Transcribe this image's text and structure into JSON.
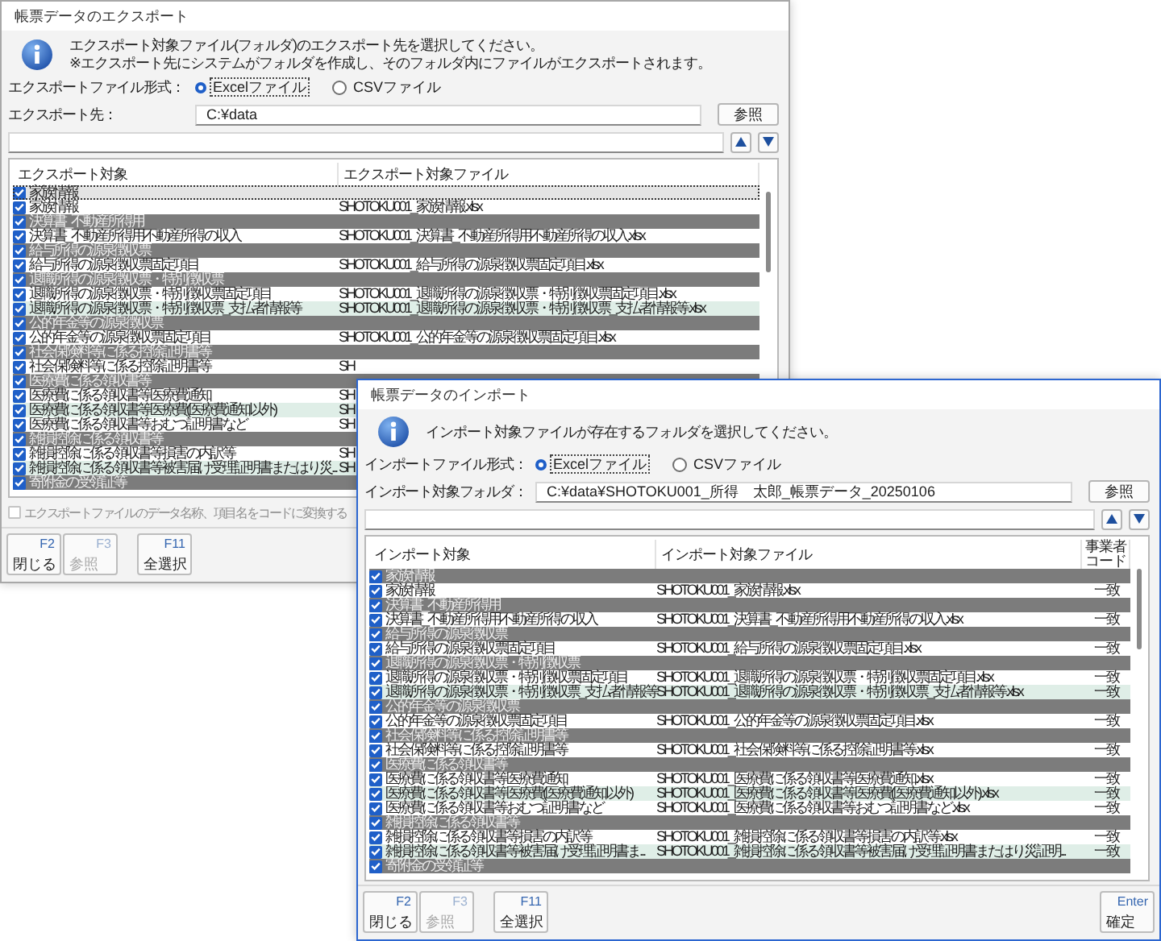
{
  "export_window": {
    "title": "帳票データのエクスポート",
    "active": false,
    "message": [
      "エクスポート対象ファイル(フォルダ)のエクスポート先を選択してください。",
      "※エクスポート先にシステムがフォルダを作成し、そのフォルダ内にファイルがエクスポートされます。"
    ],
    "format": {
      "label": "エクスポートファイル形式：",
      "options": [
        {
          "label": "Excelファイル",
          "selected": true
        },
        {
          "label": "CSVファイル",
          "selected": false
        }
      ]
    },
    "path": {
      "label": "エクスポート先：",
      "value": "C:¥data",
      "button": "参照"
    },
    "table": {
      "columns": [
        "エクスポート対象",
        "エクスポート対象ファイル"
      ],
      "rows": [
        {
          "kind": "group",
          "checked": true,
          "selected": true,
          "cells": [
            "家族情報"
          ]
        },
        {
          "kind": "item",
          "checked": true,
          "selected": false,
          "tinted": false,
          "cells": [
            "家族情報",
            "SHOTOKU001_家族情報.xlsx"
          ]
        },
        {
          "kind": "group",
          "checked": true,
          "selected": false,
          "cells": [
            "決算書_不動産所得用"
          ]
        },
        {
          "kind": "item",
          "checked": true,
          "selected": false,
          "tinted": false,
          "cells": [
            "決算書_不動産所得用不動産所得の収入",
            "SHOTOKU001_決算書_不動産所得用不動産所得の収入.xlsx"
          ]
        },
        {
          "kind": "group",
          "checked": true,
          "selected": false,
          "cells": [
            "給与所得の源泉徴収票"
          ]
        },
        {
          "kind": "item",
          "checked": true,
          "selected": false,
          "tinted": false,
          "cells": [
            "給与所得の源泉徴収票固定項目",
            "SHOTOKU001_給与所得の源泉徴収票固定項目.xlsx"
          ]
        },
        {
          "kind": "group",
          "checked": true,
          "selected": false,
          "cells": [
            "退職所得の源泉徴収票・特別徴収票"
          ]
        },
        {
          "kind": "item",
          "checked": true,
          "selected": false,
          "tinted": false,
          "cells": [
            "退職所得の源泉徴収票・特別徴収票固定項目",
            "SHOTOKU001_退職所得の源泉徴収票・特別徴収票固定項目.xlsx"
          ]
        },
        {
          "kind": "item",
          "checked": true,
          "selected": false,
          "tinted": true,
          "cells": [
            "退職所得の源泉徴収票・特別徴収票_支払者情報等",
            "SHOTOKU001_退職所得の源泉徴収票・特別徴収票_支払者情報等.xlsx"
          ]
        },
        {
          "kind": "group",
          "checked": true,
          "selected": false,
          "cells": [
            "公的年金等の源泉徴収票"
          ]
        },
        {
          "kind": "item",
          "checked": true,
          "selected": false,
          "tinted": false,
          "cells": [
            "公的年金等の源泉徴収票固定項目",
            "SHOTOKU001_公的年金等の源泉徴収票固定項目.xlsx"
          ]
        },
        {
          "kind": "group",
          "checked": true,
          "selected": false,
          "cells": [
            "社会保険料等に係る控除証明書等"
          ]
        },
        {
          "kind": "item",
          "checked": true,
          "selected": false,
          "tinted": false,
          "cells": [
            "社会保険料等に係る控除証明書等",
            "SH"
          ]
        },
        {
          "kind": "group",
          "checked": true,
          "selected": false,
          "cells": [
            "医療費に係る領収書等"
          ]
        },
        {
          "kind": "item",
          "checked": true,
          "selected": false,
          "tinted": false,
          "cells": [
            "医療費に係る領収書等医療費通知",
            "SH"
          ]
        },
        {
          "kind": "item",
          "checked": true,
          "selected": false,
          "tinted": true,
          "cells": [
            "医療費に係る領収書等医療費(医療費通知以外)",
            "SH"
          ]
        },
        {
          "kind": "item",
          "checked": true,
          "selected": false,
          "tinted": false,
          "cells": [
            "医療費に係る領収書等おむつ証明書など",
            "SH"
          ]
        },
        {
          "kind": "group",
          "checked": true,
          "selected": false,
          "cells": [
            "雑損控除に係る領収書等"
          ]
        },
        {
          "kind": "item",
          "checked": true,
          "selected": false,
          "tinted": false,
          "cells": [
            "雑損控除に係る領収書等損害の内訳等",
            "SH"
          ]
        },
        {
          "kind": "item",
          "checked": true,
          "selected": false,
          "tinted": true,
          "cells": [
            "雑損控除に係る領収書等被害届け受理証明書またはり災...",
            "SH"
          ]
        },
        {
          "kind": "group",
          "checked": true,
          "selected": false,
          "cells": [
            "寄附金の受領証等"
          ]
        }
      ]
    },
    "option": {
      "label": "エクスポートファイルのデータ名称、項目名をコードに変換する",
      "checked": false,
      "disabled": true
    },
    "footer": {
      "groups": [
        [
          {
            "key": "F2",
            "label": "閉じる",
            "disabled": false
          },
          {
            "key": "F3",
            "label": "参照",
            "disabled": true
          }
        ],
        [
          {
            "key": "F11",
            "label": "全選択",
            "disabled": false
          }
        ]
      ]
    }
  },
  "import_window": {
    "title": "帳票データのインポート",
    "active": true,
    "message": [
      "インポート対象ファイルが存在するフォルダを選択してください。"
    ],
    "format": {
      "label": "インポートファイル形式：",
      "options": [
        {
          "label": "Excelファイル",
          "selected": true
        },
        {
          "label": "CSVファイル",
          "selected": false
        }
      ]
    },
    "path": {
      "label": "インポート対象フォルダ：",
      "value": "C:¥data¥SHOTOKU001_所得　太郎_帳票データ_20250106",
      "button": "参照"
    },
    "table": {
      "columns": [
        "インポート対象",
        "インポート対象ファイル",
        "事業者コード"
      ],
      "rows": [
        {
          "kind": "group",
          "checked": true,
          "selected": false,
          "cells": [
            "家族情報"
          ]
        },
        {
          "kind": "item",
          "checked": true,
          "selected": false,
          "tinted": false,
          "cells": [
            "家族情報",
            "SHOTOKU001_家族情報.xlsx",
            "一致"
          ]
        },
        {
          "kind": "group",
          "checked": true,
          "selected": false,
          "cells": [
            "決算書_不動産所得用"
          ]
        },
        {
          "kind": "item",
          "checked": true,
          "selected": false,
          "tinted": false,
          "cells": [
            "決算書_不動産所得用不動産所得の収入",
            "SHOTOKU001_決算書_不動産所得用不動産所得の収入.xlsx",
            "一致"
          ]
        },
        {
          "kind": "group",
          "checked": true,
          "selected": false,
          "cells": [
            "給与所得の源泉徴収票"
          ]
        },
        {
          "kind": "item",
          "checked": true,
          "selected": false,
          "tinted": false,
          "cells": [
            "給与所得の源泉徴収票固定項目",
            "SHOTOKU001_給与所得の源泉徴収票固定項目.xlsx",
            "一致"
          ]
        },
        {
          "kind": "group",
          "checked": true,
          "selected": false,
          "cells": [
            "退職所得の源泉徴収票・特別徴収票"
          ]
        },
        {
          "kind": "item",
          "checked": true,
          "selected": false,
          "tinted": false,
          "cells": [
            "退職所得の源泉徴収票・特別徴収票固定項目",
            "SHOTOKU001_退職所得の源泉徴収票・特別徴収票固定項目.xlsx",
            "一致"
          ]
        },
        {
          "kind": "item",
          "checked": true,
          "selected": false,
          "tinted": true,
          "cells": [
            "退職所得の源泉徴収票・特別徴収票_支払者情報等",
            "SHOTOKU001_退職所得の源泉徴収票・特別徴収票_支払者情報等.xlsx",
            "一致"
          ]
        },
        {
          "kind": "group",
          "checked": true,
          "selected": false,
          "cells": [
            "公的年金等の源泉徴収票"
          ]
        },
        {
          "kind": "item",
          "checked": true,
          "selected": false,
          "tinted": false,
          "cells": [
            "公的年金等の源泉徴収票固定項目",
            "SHOTOKU001_公的年金等の源泉徴収票固定項目.xlsx",
            "一致"
          ]
        },
        {
          "kind": "group",
          "checked": true,
          "selected": false,
          "cells": [
            "社会保険料等に係る控除証明書等"
          ]
        },
        {
          "kind": "item",
          "checked": true,
          "selected": false,
          "tinted": false,
          "cells": [
            "社会保険料等に係る控除証明書等",
            "SHOTOKU001_社会保険料等に係る控除証明書等.xlsx",
            "一致"
          ]
        },
        {
          "kind": "group",
          "checked": true,
          "selected": false,
          "cells": [
            "医療費に係る領収書等"
          ]
        },
        {
          "kind": "item",
          "checked": true,
          "selected": false,
          "tinted": false,
          "cells": [
            "医療費に係る領収書等医療費通知",
            "SHOTOKU001_医療費に係る領収書等医療費通知.xlsx",
            "一致"
          ]
        },
        {
          "kind": "item",
          "checked": true,
          "selected": false,
          "tinted": true,
          "cells": [
            "医療費に係る領収書等医療費(医療費通知以外)",
            "SHOTOKU001_医療費に係る領収書等医療費(医療費通知以外).xlsx",
            "一致"
          ]
        },
        {
          "kind": "item",
          "checked": true,
          "selected": false,
          "tinted": false,
          "cells": [
            "医療費に係る領収書等おむつ証明書など",
            "SHOTOKU001_医療費に係る領収書等おむつ証明書など.xlsx",
            "一致"
          ]
        },
        {
          "kind": "group",
          "checked": true,
          "selected": false,
          "cells": [
            "雑損控除に係る領収書等"
          ]
        },
        {
          "kind": "item",
          "checked": true,
          "selected": false,
          "tinted": false,
          "cells": [
            "雑損控除に係る領収書等損害の内訳等",
            "SHOTOKU001_雑損控除に係る領収書等損害の内訳等.xlsx",
            "一致"
          ]
        },
        {
          "kind": "item",
          "checked": true,
          "selected": false,
          "tinted": true,
          "cells": [
            "雑損控除に係る領収書等被害届け受理証明書ま...",
            "SHOTOKU001_雑損控除に係る領収書等被害届け受理証明書またはり災証明...",
            "一致"
          ]
        },
        {
          "kind": "group",
          "checked": true,
          "selected": false,
          "cells": [
            "寄附金の受領証等"
          ]
        }
      ]
    },
    "footer": {
      "groups": [
        [
          {
            "key": "F2",
            "label": "閉じる",
            "disabled": false
          },
          {
            "key": "F3",
            "label": "参照",
            "disabled": true
          }
        ],
        [
          {
            "key": "F11",
            "label": "全選択",
            "disabled": false
          }
        ]
      ],
      "confirm": {
        "key": "Enter",
        "label": "確定",
        "disabled": false
      }
    }
  }
}
